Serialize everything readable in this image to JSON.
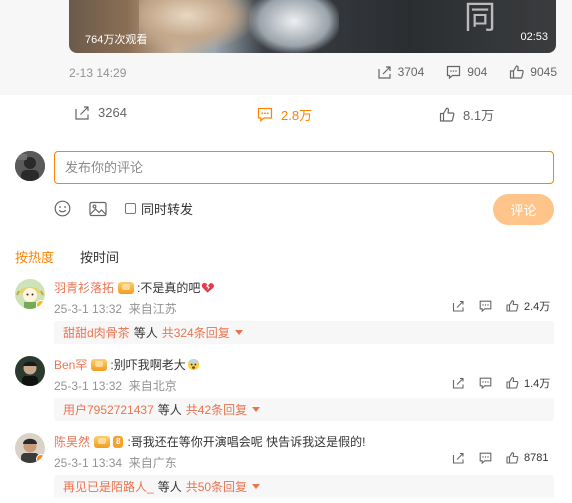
{
  "repost": {
    "video": {
      "views": "764万次观看",
      "duration": "02:53",
      "calligraphy": "同"
    },
    "date": "2-13 14:29",
    "shares": "3704",
    "comments": "904",
    "likes": "9045"
  },
  "post_actions": {
    "shares": "3264",
    "comments": "2.8万",
    "likes": "8.1万"
  },
  "composer": {
    "placeholder": "发布你的评论",
    "repost_option": "同时转发",
    "submit_label": "评论"
  },
  "sort": {
    "tabs": [
      "按热度",
      "按时间"
    ],
    "active": 0
  },
  "comments": [
    {
      "user": "羽青衫落拓",
      "text": ":不是真的吧",
      "time": "25-3-1 13:32",
      "location": "来自江苏",
      "likes": "2.4万",
      "reply_user": "甜甜d肉骨茶",
      "reply_mid": "等人",
      "reply_count": "共324条回复"
    },
    {
      "user": "Ben罕",
      "text": ":别吓我啊老大",
      "time": "25-3-1 13:32",
      "location": "来自北京",
      "likes": "1.4万",
      "reply_user": "用户7952721437",
      "reply_mid": "等人",
      "reply_count": "共42条回复"
    },
    {
      "user": "陈昊然",
      "text": ":哥我还在等你开演唱会呢 快告诉我这是假的!",
      "time": "25-3-1 13:34",
      "location": "来自广东",
      "likes": "8781",
      "medal_level": "8",
      "reply_user": "再见已是陌路人_",
      "reply_mid": "等人",
      "reply_count": "共50条回复"
    }
  ],
  "colors": {
    "accent": "#ff8200",
    "username": "#eb7350",
    "submit_disabled": "#ffc48a",
    "muted": "#939393"
  }
}
